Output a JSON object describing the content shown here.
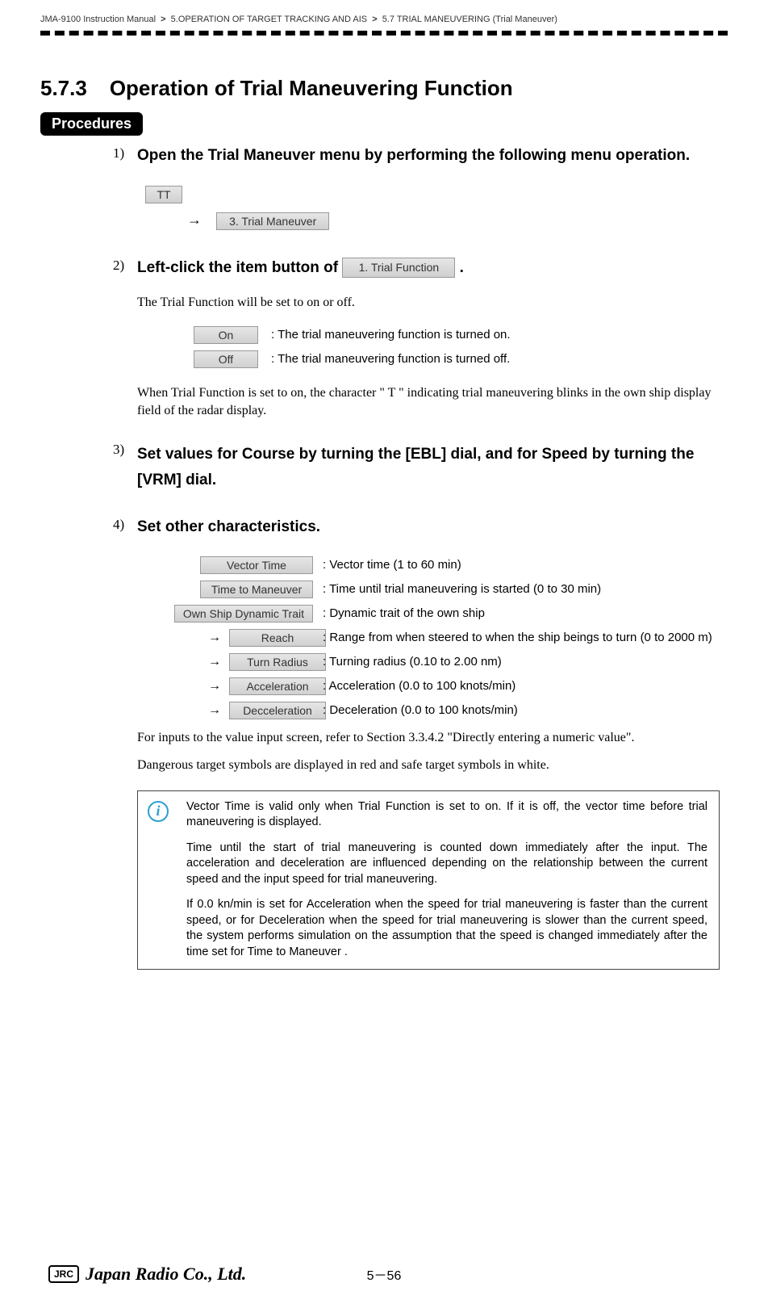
{
  "header": {
    "manual": "JMA-9100 Instruction Manual",
    "gt": ">",
    "ch": "5.OPERATION OF TARGET TRACKING AND AIS",
    "sect": "5.7  TRIAL MANEUVERING (Trial Maneuver)"
  },
  "section": {
    "num": "5.7.3",
    "title": "Operation of Trial Maneuvering Function"
  },
  "procedures_label": "Procedures",
  "steps": {
    "s1": {
      "num": "1)",
      "head": "Open the Trial Maneuver menu by performing the following menu operation.",
      "btn_tt": "TT",
      "arrow": "→",
      "btn_trial": "3. Trial Maneuver"
    },
    "s2": {
      "num": "2)",
      "head_before": "Left-click the item button of ",
      "btn_func": "1. Trial Function",
      "head_after": " .",
      "desc1": "The Trial Function will be set to on or off.",
      "on": "On",
      "on_desc": ": The trial maneuvering function is turned on.",
      "off": "Off",
      "off_desc": ": The trial maneuvering function is turned off.",
      "desc2": "When Trial Function is set to on, the character \" T \" indicating trial maneuvering blinks in the own ship display field of the radar display."
    },
    "s3": {
      "num": "3)",
      "head": "Set values for Course by turning the [EBL] dial, and for Speed by turning the [VRM] dial."
    },
    "s4": {
      "num": "4)",
      "head": "Set other characteristics.",
      "rows": {
        "vt": {
          "label": "Vector Time",
          "desc": ": Vector time (1 to 60 min)"
        },
        "tm": {
          "label": "Time to Maneuver",
          "desc": ": Time until trial maneuvering is started (0 to 30 min)"
        },
        "os": {
          "label": "Own Ship Dynamic Trait",
          "desc": ": Dynamic trait of the own ship"
        },
        "arrow": "→",
        "reach": {
          "label": "Reach",
          "desc": ": Range from when steered to when the ship beings to turn (0 to 2000 m)"
        },
        "turn": {
          "label": "Turn Radius",
          "desc": ": Turning radius (0.10 to 2.00 nm)"
        },
        "acc": {
          "label": "Acceleration",
          "desc": ": Acceleration (0.0 to 100 knots/min)"
        },
        "dec": {
          "label": "Decceleration",
          "desc": ": Deceleration (0.0 to 100 knots/min)"
        }
      },
      "note1": "For inputs to the value input screen, refer to Section 3.3.4.2 \"Directly entering a numeric value\".",
      "note2": "Dangerous target symbols are displayed in red and safe target symbols in white."
    }
  },
  "info": {
    "p1": "Vector Time is valid only when Trial Function is set to on. If it is off, the vector time before trial maneuvering is displayed.",
    "p2": "Time until the start of trial maneuvering is counted down immediately after the input. The acceleration and deceleration are influenced depending on the relationship between the current speed and the input speed for trial maneuvering.",
    "p3": "If 0.0 kn/min is set for  Acceleration  when the speed for trial maneuvering is faster than the current speed, or for  Deceleration  when the speed for trial maneuvering is slower than the current speed, the system performs simulation on the assumption that the speed is changed immediately after the time set for Time to Maneuver ."
  },
  "footer": {
    "jrc": "JRC",
    "brand": "Japan Radio Co., Ltd.",
    "page": "5－56"
  }
}
